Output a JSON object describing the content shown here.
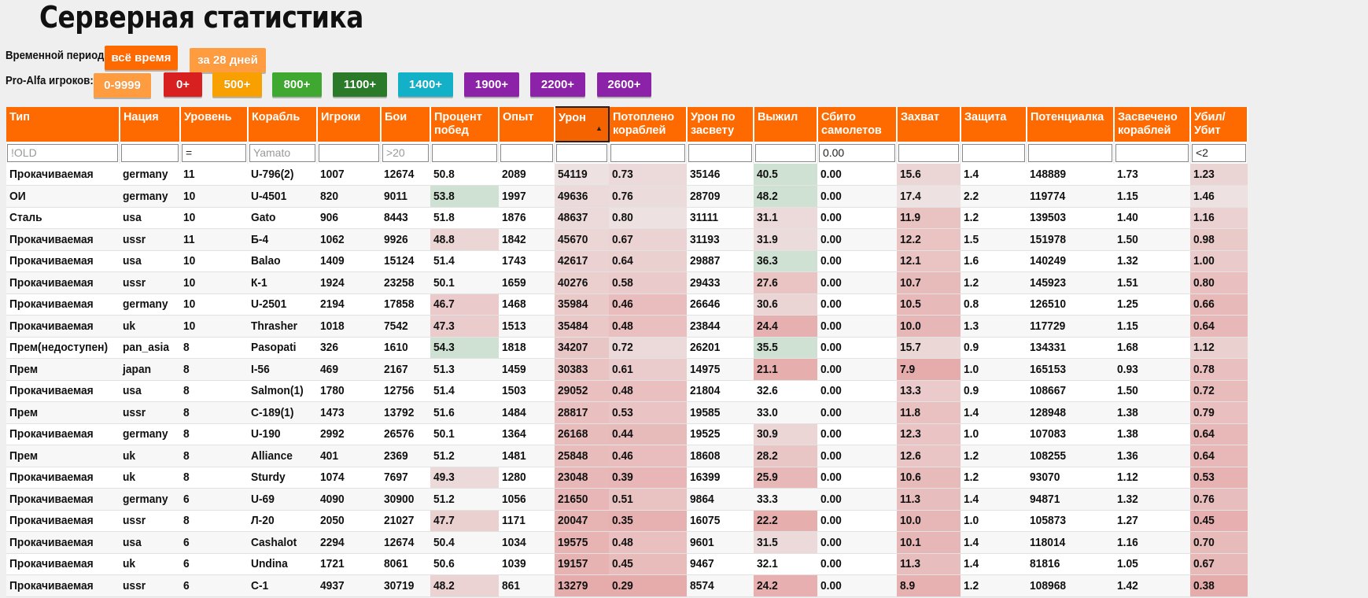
{
  "page_title": "Серверная статистика",
  "filters": {
    "period_label": "Временной период:",
    "period_buttons": [
      {
        "label": "всё время",
        "color": "#ff6a00",
        "active": true
      },
      {
        "label": "за 28 дней",
        "color": "#ff9c40",
        "active": false
      }
    ],
    "players_label": "Pro-Alfa игроков:",
    "players_buttons": [
      {
        "label": "0-9999",
        "color": "#ff9c40"
      },
      {
        "label": "0+",
        "color": "#d92020"
      },
      {
        "label": "500+",
        "color": "#f7a000"
      },
      {
        "label": "800+",
        "color": "#3ea830"
      },
      {
        "label": "1100+",
        "color": "#2a7a2a"
      },
      {
        "label": "1400+",
        "color": "#13b1c8"
      },
      {
        "label": "1900+",
        "color": "#8c22a8"
      },
      {
        "label": "2200+",
        "color": "#8c22a8"
      },
      {
        "label": "2600+",
        "color": "#8c22a8"
      }
    ]
  },
  "table": {
    "columns": [
      "Тип",
      "Нация",
      "Уровень",
      "Корабль",
      "Игроки",
      "Бои",
      "Процент побед",
      "Опыт",
      "Урон",
      "Потоплено кораблей",
      "Урон по засвету",
      "Выжил",
      "Сбито самолетов",
      "Захват",
      "Защита",
      "Потенциалка",
      "Засвечено кораблей",
      "Убил/ Убит"
    ],
    "sorted_column": "Урон",
    "filter_values": [
      "",
      "",
      "=",
      "",
      "",
      "",
      "",
      "",
      "",
      "",
      "",
      "",
      "0.00",
      "",
      "",
      "",
      "",
      "<2"
    ],
    "filter_placeholders": [
      "!OLD",
      "",
      "",
      "Yamato",
      "",
      ">20",
      "",
      "",
      "",
      "",
      "",
      "",
      "",
      "",
      "",
      "",
      "",
      ""
    ],
    "rows": [
      [
        "Прокачиваемая",
        "germany",
        "11",
        "U-796(2)",
        "1007",
        "12674",
        "50.8",
        "2089",
        "54119",
        "0.73",
        "35146",
        "40.5",
        "0.00",
        "15.6",
        "1.4",
        "148889",
        "1.73",
        "1.23"
      ],
      [
        "ОИ",
        "germany",
        "10",
        "U-4501",
        "820",
        "9011",
        "53.8",
        "1997",
        "49636",
        "0.76",
        "28709",
        "48.2",
        "0.00",
        "17.4",
        "2.2",
        "119774",
        "1.15",
        "1.46"
      ],
      [
        "Сталь",
        "usa",
        "10",
        "Gato",
        "906",
        "8443",
        "51.8",
        "1876",
        "48637",
        "0.80",
        "31111",
        "31.1",
        "0.00",
        "11.9",
        "1.2",
        "139503",
        "1.40",
        "1.16"
      ],
      [
        "Прокачиваемая",
        "ussr",
        "11",
        "Б-4",
        "1062",
        "9926",
        "48.8",
        "1842",
        "45670",
        "0.67",
        "31193",
        "31.9",
        "0.00",
        "12.2",
        "1.5",
        "151978",
        "1.50",
        "0.98"
      ],
      [
        "Прокачиваемая",
        "usa",
        "10",
        "Balao",
        "1409",
        "15124",
        "51.4",
        "1743",
        "42617",
        "0.64",
        "29887",
        "36.3",
        "0.00",
        "12.1",
        "1.6",
        "140249",
        "1.32",
        "1.00"
      ],
      [
        "Прокачиваемая",
        "ussr",
        "10",
        "К-1",
        "1924",
        "23258",
        "50.1",
        "1659",
        "40276",
        "0.58",
        "29433",
        "27.6",
        "0.00",
        "10.7",
        "1.2",
        "145923",
        "1.51",
        "0.80"
      ],
      [
        "Прокачиваемая",
        "germany",
        "10",
        "U-2501",
        "2194",
        "17858",
        "46.7",
        "1468",
        "35984",
        "0.46",
        "26646",
        "30.6",
        "0.00",
        "10.5",
        "0.8",
        "126510",
        "1.25",
        "0.66"
      ],
      [
        "Прокачиваемая",
        "uk",
        "10",
        "Thrasher",
        "1018",
        "7542",
        "47.3",
        "1513",
        "35484",
        "0.48",
        "23844",
        "24.4",
        "0.00",
        "10.0",
        "1.3",
        "117729",
        "1.15",
        "0.64"
      ],
      [
        "Прем(недоступен)",
        "pan_asia",
        "8",
        "Pasopati",
        "326",
        "1610",
        "54.3",
        "1818",
        "34207",
        "0.72",
        "26201",
        "35.5",
        "0.00",
        "15.7",
        "0.9",
        "134331",
        "1.68",
        "1.12"
      ],
      [
        "Прем",
        "japan",
        "8",
        "I-56",
        "469",
        "2167",
        "51.3",
        "1459",
        "30383",
        "0.61",
        "14975",
        "21.1",
        "0.00",
        "7.9",
        "1.0",
        "165153",
        "0.93",
        "0.78"
      ],
      [
        "Прокачиваемая",
        "usa",
        "8",
        "Salmon(1)",
        "1780",
        "12756",
        "51.4",
        "1503",
        "29052",
        "0.48",
        "21804",
        "32.6",
        "0.00",
        "13.3",
        "0.9",
        "108667",
        "1.50",
        "0.72"
      ],
      [
        "Прем",
        "ussr",
        "8",
        "С-189(1)",
        "1473",
        "13792",
        "51.6",
        "1484",
        "28817",
        "0.53",
        "19585",
        "33.0",
        "0.00",
        "11.8",
        "1.4",
        "128948",
        "1.38",
        "0.79"
      ],
      [
        "Прокачиваемая",
        "germany",
        "8",
        "U-190",
        "2992",
        "26576",
        "50.1",
        "1364",
        "26168",
        "0.44",
        "19525",
        "30.9",
        "0.00",
        "12.3",
        "1.0",
        "107083",
        "1.38",
        "0.64"
      ],
      [
        "Прем",
        "uk",
        "8",
        "Alliance",
        "401",
        "2369",
        "51.2",
        "1481",
        "25848",
        "0.46",
        "18608",
        "28.2",
        "0.00",
        "12.6",
        "1.2",
        "108255",
        "1.36",
        "0.64"
      ],
      [
        "Прокачиваемая",
        "uk",
        "8",
        "Sturdy",
        "1074",
        "7697",
        "49.3",
        "1280",
        "23048",
        "0.39",
        "16399",
        "25.9",
        "0.00",
        "10.6",
        "1.2",
        "93070",
        "1.12",
        "0.53"
      ],
      [
        "Прокачиваемая",
        "germany",
        "6",
        "U-69",
        "4090",
        "30900",
        "51.2",
        "1056",
        "21650",
        "0.51",
        "9864",
        "33.3",
        "0.00",
        "11.3",
        "1.4",
        "94871",
        "1.32",
        "0.76"
      ],
      [
        "Прокачиваемая",
        "ussr",
        "8",
        "Л-20",
        "2050",
        "21027",
        "47.7",
        "1171",
        "20047",
        "0.35",
        "16075",
        "22.2",
        "0.00",
        "10.0",
        "1.0",
        "105873",
        "1.27",
        "0.45"
      ],
      [
        "Прокачиваемая",
        "usa",
        "6",
        "Cashalot",
        "2294",
        "12674",
        "50.4",
        "1034",
        "19575",
        "0.48",
        "9601",
        "31.5",
        "0.00",
        "10.1",
        "1.4",
        "118014",
        "1.16",
        "0.70"
      ],
      [
        "Прокачиваемая",
        "uk",
        "6",
        "Undina",
        "1721",
        "8061",
        "50.6",
        "1039",
        "19157",
        "0.45",
        "9467",
        "32.1",
        "0.00",
        "11.3",
        "1.4",
        "81816",
        "1.05",
        "0.67"
      ],
      [
        "Прокачиваемая",
        "ussr",
        "6",
        "С-1",
        "4937",
        "30719",
        "48.2",
        "861",
        "13279",
        "0.29",
        "8574",
        "24.2",
        "0.00",
        "8.9",
        "1.2",
        "108968",
        "1.42",
        "0.38"
      ]
    ]
  }
}
